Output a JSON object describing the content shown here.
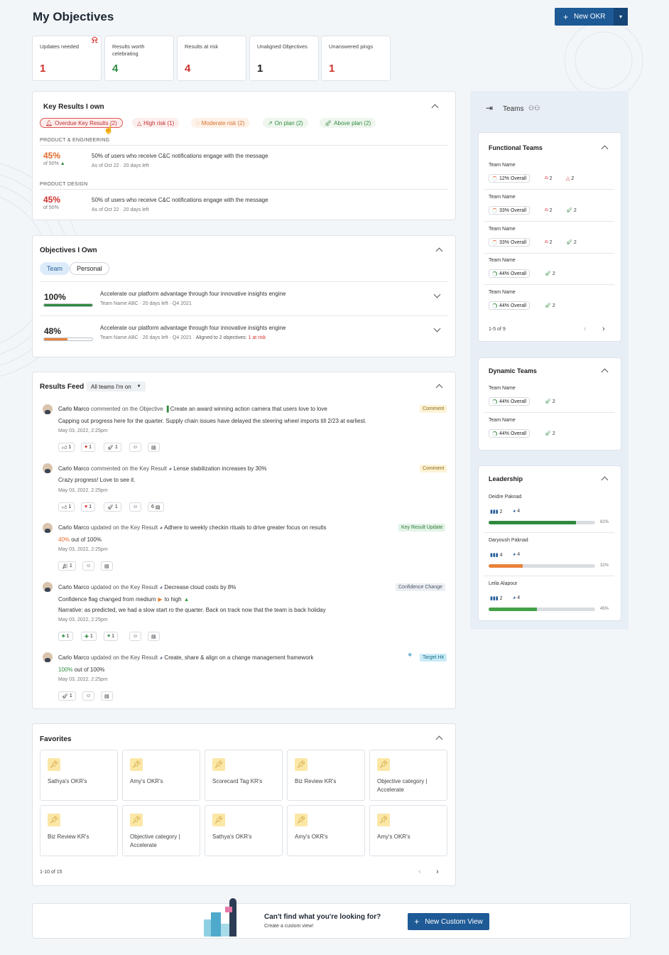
{
  "header": {
    "title": "My Objectives",
    "new_okr": "New OKR"
  },
  "stats": [
    {
      "label": "Updates needed",
      "value": "1",
      "color": "#d0312d"
    },
    {
      "label": "Results worth celebrating",
      "value": "4",
      "color": "#2f8a3e"
    },
    {
      "label": "Results at risk",
      "value": "4",
      "color": "#d0312d"
    },
    {
      "label": "Unaligned Objectives",
      "value": "1",
      "color": "#222222"
    },
    {
      "label": "Unanswered pings",
      "value": "1",
      "color": "#d0312d"
    }
  ],
  "key_results": {
    "title": "Key Results I own",
    "chips": [
      "Overdue Key Results (2)",
      "High risk (1)",
      "Moderate risk (2)",
      "On plan (2)",
      "Above plan (2)"
    ],
    "groups": [
      {
        "caption": "PRODUCT & ENGINEERING",
        "pct": "45%",
        "of": "of 50%",
        "text": "50% of users who receive C&C notifications engage with the message",
        "meta": "As of Oct 22  ·  20 days left"
      },
      {
        "caption": "PRODUCT DESIGN",
        "pct": "45%",
        "of": "of 50%",
        "text": "50% of users who receive C&C notifications engage with the message",
        "meta": "As of Oct 22  ·  20 days left"
      }
    ]
  },
  "objectives": {
    "title": "Objectives I Own",
    "tabs": [
      "Team",
      "Personal"
    ],
    "items": [
      {
        "pct": "100%",
        "progress": 1.0,
        "color": "#2f8a3e",
        "text": "Accelerate our platform advantage through four innovative insights engine",
        "meta": "Team Name ABC  ·  20 days left  ·  Q4 2021",
        "extra": "",
        "risk": ""
      },
      {
        "pct": "48%",
        "progress": 0.48,
        "color": "#e8823a",
        "text": "Accelerate our platform advantage through four innovative insights engine",
        "meta": "Team Name ABC  ·  20 days left  ·  Q4 2021  ·  ",
        "extra": "Aligned to 2 objectives: ",
        "risk": "1 at risk"
      }
    ]
  },
  "feed": {
    "title": "Results Feed",
    "filter": "All teams I'm on",
    "items": [
      {
        "author": "Carlo Marco",
        "action": "commented on the Objective",
        "target": "Create an award winning action camera that users love to love",
        "tag": "Comment",
        "body": "Capping out progress here for the quarter. Supply chain issues have delayed the steering wheel imports till 2/23 at earliest.",
        "body2": "",
        "date": "May 03, 2022, 2:25pm",
        "reactions": [
          "1",
          "1",
          "1"
        ]
      },
      {
        "author": "Carlo Marco",
        "action": "commented on the Key Result",
        "target": "Lense stabilization increases by 30%",
        "tag": "Comment",
        "body": "Crazy progress! Love to see it.",
        "body2": "",
        "date": "May 03, 2022, 2:25pm",
        "reactions": [
          "1",
          "1",
          "1",
          "6"
        ]
      },
      {
        "author": "Carlo Marco",
        "action": "updated on the Key Result",
        "target": "Adhere to weekly checkin rituals to drive greater focus on results",
        "tag": "Key Result Update",
        "body_hl": "40%",
        "body": " out of 100%",
        "body2": "",
        "date": "May 03, 2022, 2:25pm",
        "reactions": [
          "1"
        ]
      },
      {
        "author": "Carlo Marco",
        "action": "updated on the Key Result",
        "target": "Decrease cloud costs by 8%",
        "tag": "Confidence Change",
        "body": "Confidence flag changed from medium",
        "body_to": "to high",
        "body2": "Narrative: as predicted, we had a slow start ro the quarter. Back on track now that the team is back holiday",
        "date": "May 03, 2022, 2:25pm",
        "reactions": [
          "1",
          "1",
          "1"
        ]
      },
      {
        "author": "Carlo Marco",
        "action": "updated on the Key Result",
        "target": "Create, share & align on a change management framework",
        "tag": "Target Hit",
        "body_hl": "100%",
        "body": " out of 100%",
        "body2": "",
        "date": "May 03, 2022, 2:25pm",
        "reactions": [
          "1"
        ]
      }
    ]
  },
  "favorites": {
    "title": "Favorites",
    "items": [
      "Sathya's OKR's",
      "Amy's OKR's",
      "Scorecard Tag KR's",
      "Biz Review KR's",
      "Objective category | Accelerate",
      "Biz Review KR's",
      "Objective category | Accelerate",
      "Sathya's OKR's",
      "Amy's OKR's",
      "Amy's OKR's"
    ],
    "pager": "1-10 of 15"
  },
  "footer": {
    "title": "Can't find what you're looking for?",
    "subtitle": "Create a custom view!",
    "button": "New Custom View"
  },
  "teams": {
    "title": "Teams",
    "functional": {
      "title": "Functional Teams",
      "pager": "1-5 of 9",
      "rows": [
        {
          "name": "Team Name",
          "overall": "12% Overall",
          "a": "2",
          "b": "2",
          "b_type": "risk"
        },
        {
          "name": "Team Name",
          "overall": "33% Overall",
          "a": "2",
          "b": "2",
          "b_type": "rocket"
        },
        {
          "name": "Team Name",
          "overall": "33% Overall",
          "a": "2",
          "b": "2",
          "b_type": "rocket"
        },
        {
          "name": "Team Name",
          "overall": "44% Overall",
          "a": "",
          "b": "2",
          "b_type": "rocket"
        },
        {
          "name": "Team Name",
          "overall": "44% Overall",
          "a": "",
          "b": "2",
          "b_type": "rocket"
        }
      ]
    },
    "dynamic": {
      "title": "Dynamic Teams",
      "rows": [
        {
          "name": "Team Name",
          "overall": "44% Overall",
          "b": "2"
        },
        {
          "name": "Team Name",
          "overall": "44% Overall",
          "b": "2"
        }
      ]
    },
    "leadership": {
      "title": "Leadership",
      "people": [
        {
          "name": "Deidre Paknad",
          "c1": "2",
          "c2": "4",
          "pct": "82%",
          "progress": 0.82,
          "color": "#2f8a3e"
        },
        {
          "name": "Daryoush Paknad",
          "c1": "4",
          "c2": "4",
          "pct": "32%",
          "progress": 0.32,
          "color": "#e8823a"
        },
        {
          "name": "Leila Alapour",
          "c1": "2",
          "c2": "4",
          "pct": "45%",
          "progress": 0.45,
          "color": "#43a047"
        }
      ]
    }
  }
}
